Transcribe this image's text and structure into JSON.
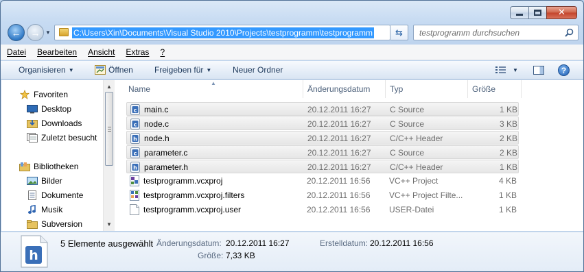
{
  "window": {
    "controls": {
      "minimize": "minimize",
      "maximize": "maximize",
      "close": "close"
    }
  },
  "address_bar": {
    "path": "C:\\Users\\Xin\\Documents\\Visual Studio 2010\\Projects\\testprogramm\\testprogramm"
  },
  "search": {
    "placeholder": "testprogramm durchsuchen"
  },
  "menu": [
    "Datei",
    "Bearbeiten",
    "Ansicht",
    "Extras",
    "?"
  ],
  "toolbar": {
    "organize": "Organisieren",
    "open": "Öffnen",
    "share": "Freigeben für",
    "new_folder": "Neuer Ordner"
  },
  "nav_pane": {
    "favorites_header": "Favoriten",
    "favorites": [
      "Desktop",
      "Downloads",
      "Zuletzt besucht"
    ],
    "libraries_header": "Bibliotheken",
    "libraries": [
      "Bilder",
      "Dokumente",
      "Musik",
      "Subversion"
    ]
  },
  "columns": [
    "Name",
    "Änderungsdatum",
    "Typ",
    "Größe"
  ],
  "files": [
    {
      "name": "main.c",
      "date": "20.12.2011 16:27",
      "type": "C Source",
      "size": "1 KB",
      "selected": true,
      "icon": "c-source-icon"
    },
    {
      "name": "node.c",
      "date": "20.12.2011 16:27",
      "type": "C Source",
      "size": "3 KB",
      "selected": true,
      "icon": "c-source-icon"
    },
    {
      "name": "node.h",
      "date": "20.12.2011 16:27",
      "type": "C/C++ Header",
      "size": "2 KB",
      "selected": true,
      "icon": "c-header-icon"
    },
    {
      "name": "parameter.c",
      "date": "20.12.2011 16:27",
      "type": "C Source",
      "size": "2 KB",
      "selected": true,
      "icon": "c-source-icon"
    },
    {
      "name": "parameter.h",
      "date": "20.12.2011 16:27",
      "type": "C/C++ Header",
      "size": "1 KB",
      "selected": true,
      "icon": "c-header-icon"
    },
    {
      "name": "testprogramm.vcxproj",
      "date": "20.12.2011 16:56",
      "type": "VC++ Project",
      "size": "4 KB",
      "selected": false,
      "icon": "vcxproj-icon"
    },
    {
      "name": "testprogramm.vcxproj.filters",
      "date": "20.12.2011 16:56",
      "type": "VC++ Project Filte...",
      "size": "1 KB",
      "selected": false,
      "icon": "vcxproj-filters-icon"
    },
    {
      "name": "testprogramm.vcxproj.user",
      "date": "20.12.2011 16:56",
      "type": "USER-Datei",
      "size": "1 KB",
      "selected": false,
      "icon": "blank-file-icon"
    }
  ],
  "details": {
    "summary": "5 Elemente ausgewählt",
    "modified_label": "Änderungsdatum:",
    "modified_value": "20.12.2011 16:27",
    "created_label": "Erstelldatum:",
    "created_value": "20.12.2011 16:56",
    "size_label": "Größe:",
    "size_value": "7,33 KB"
  },
  "colors": {
    "selection_blue": "#3399ff",
    "nav_text": "#1e395b",
    "secondary_text": "#6d6d6d"
  }
}
